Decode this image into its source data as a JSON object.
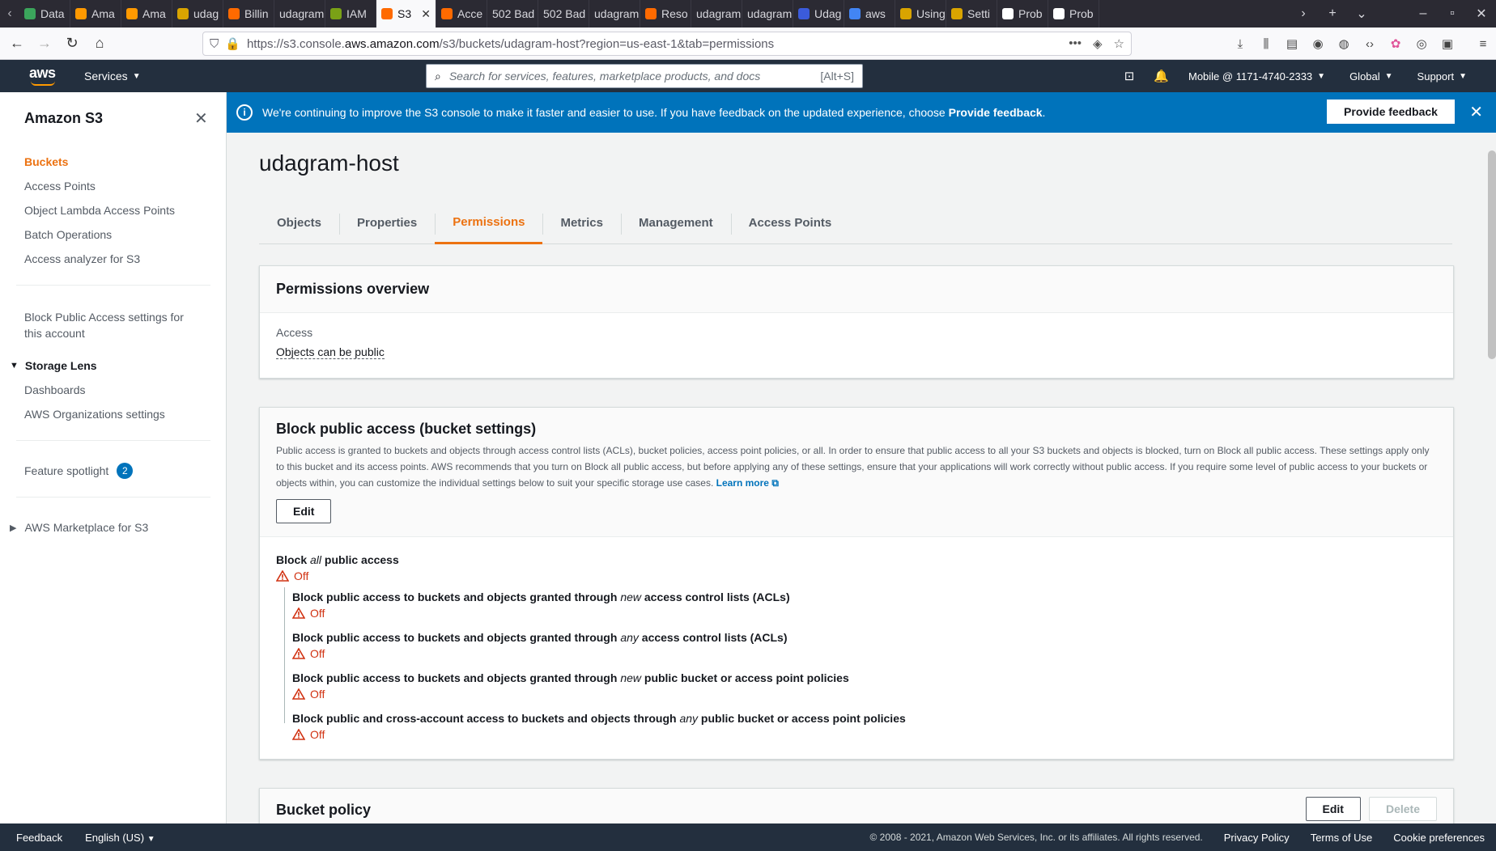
{
  "browser": {
    "tabs": [
      {
        "label": "Data",
        "color": "#3ba55c"
      },
      {
        "label": "Ama",
        "color": "#ff9900"
      },
      {
        "label": "Ama",
        "color": "#ff9900"
      },
      {
        "label": "udag",
        "color": "#d9a400"
      },
      {
        "label": "Billin",
        "color": "#ff6a00"
      },
      {
        "label": "udagram",
        "color": ""
      },
      {
        "label": "IAM",
        "color": "#7aa116"
      },
      {
        "label": "S3",
        "color": "#ff6a00",
        "active": true
      },
      {
        "label": "Acce",
        "color": "#ff6a00"
      },
      {
        "label": "502 Bad",
        "color": ""
      },
      {
        "label": "502 Bad",
        "color": ""
      },
      {
        "label": "udagram",
        "color": ""
      },
      {
        "label": "Reso",
        "color": "#ff6a00"
      },
      {
        "label": "udagram",
        "color": ""
      },
      {
        "label": "udagram",
        "color": ""
      },
      {
        "label": "Udag",
        "color": "#3b5bdb"
      },
      {
        "label": "aws",
        "color": "#4285f4"
      },
      {
        "label": "Using",
        "color": "#d9a400"
      },
      {
        "label": "Setti",
        "color": "#d9a400"
      },
      {
        "label": "Prob",
        "color": "#ffffff"
      },
      {
        "label": "Prob",
        "color": "#ffffff"
      }
    ],
    "url_prefix": "https://s3.console.",
    "url_host": "aws.amazon.com",
    "url_path": "/s3/buckets/udagram-host?region=us-east-1&tab=permissions"
  },
  "aws_nav": {
    "services_label": "Services",
    "search_placeholder": "Search for services, features, marketplace products, and docs",
    "search_shortcut": "[Alt+S]",
    "account": "Mobile @ 1171-4740-2333",
    "region": "Global",
    "support": "Support"
  },
  "sidebar": {
    "title": "Amazon S3",
    "items": [
      "Buckets",
      "Access Points",
      "Object Lambda Access Points",
      "Batch Operations",
      "Access analyzer for S3"
    ],
    "block_public_line1": "Block Public Access settings for",
    "block_public_line2": "this account",
    "storage_lens": "Storage Lens",
    "storage_lens_items": [
      "Dashboards",
      "AWS Organizations settings"
    ],
    "feature_spotlight": "Feature spotlight",
    "feature_spotlight_count": "2",
    "marketplace": "AWS Marketplace for S3"
  },
  "banner": {
    "text_before": "We're continuing to improve the S3 console to make it faster and easier to use. If you have feedback on the updated experience, choose ",
    "text_bold": "Provide feedback",
    "text_after": ".",
    "button": "Provide feedback"
  },
  "main": {
    "bucket_name": "udagram-host",
    "tabs": [
      "Objects",
      "Properties",
      "Permissions",
      "Metrics",
      "Management",
      "Access Points"
    ],
    "active_tab": "Permissions",
    "overview": {
      "title": "Permissions overview",
      "access_label": "Access",
      "access_value": "Objects can be public"
    },
    "block_public": {
      "title": "Block public access (bucket settings)",
      "description": "Public access is granted to buckets and objects through access control lists (ACLs), bucket policies, access point policies, or all. In order to ensure that public access to all your S3 buckets and objects is blocked, turn on Block all public access. These settings apply only to this bucket and its access points. AWS recommends that you turn on Block all public access, but before applying any of these settings, ensure that your applications will work correctly without public access. If you require some level of public access to your buckets or objects within, you can customize the individual settings below to suit your specific storage use cases.",
      "learn_more": "Learn more",
      "edit_label": "Edit",
      "all_prefix": "Block ",
      "all_em": "all",
      "all_suffix": " public access",
      "status": "Off",
      "settings": [
        {
          "prefix": "Block public access to buckets and objects granted through ",
          "em": "new",
          "suffix": " access control lists (ACLs)",
          "status": "Off"
        },
        {
          "prefix": "Block public access to buckets and objects granted through ",
          "em": "any",
          "suffix": " access control lists (ACLs)",
          "status": "Off"
        },
        {
          "prefix": "Block public access to buckets and objects granted through ",
          "em": "new",
          "suffix": " public bucket or access point policies",
          "status": "Off"
        },
        {
          "prefix": "Block public and cross-account access to buckets and objects through ",
          "em": "any",
          "suffix": " public bucket or access point policies",
          "status": "Off"
        }
      ]
    },
    "bucket_policy": {
      "title": "Bucket policy",
      "edit_label": "Edit",
      "delete_label": "Delete"
    }
  },
  "footer": {
    "feedback": "Feedback",
    "language": "English (US)",
    "copyright": "© 2008 - 2021, Amazon Web Services, Inc. or its affiliates. All rights reserved.",
    "privacy": "Privacy Policy",
    "terms": "Terms of Use",
    "cookies": "Cookie preferences"
  }
}
